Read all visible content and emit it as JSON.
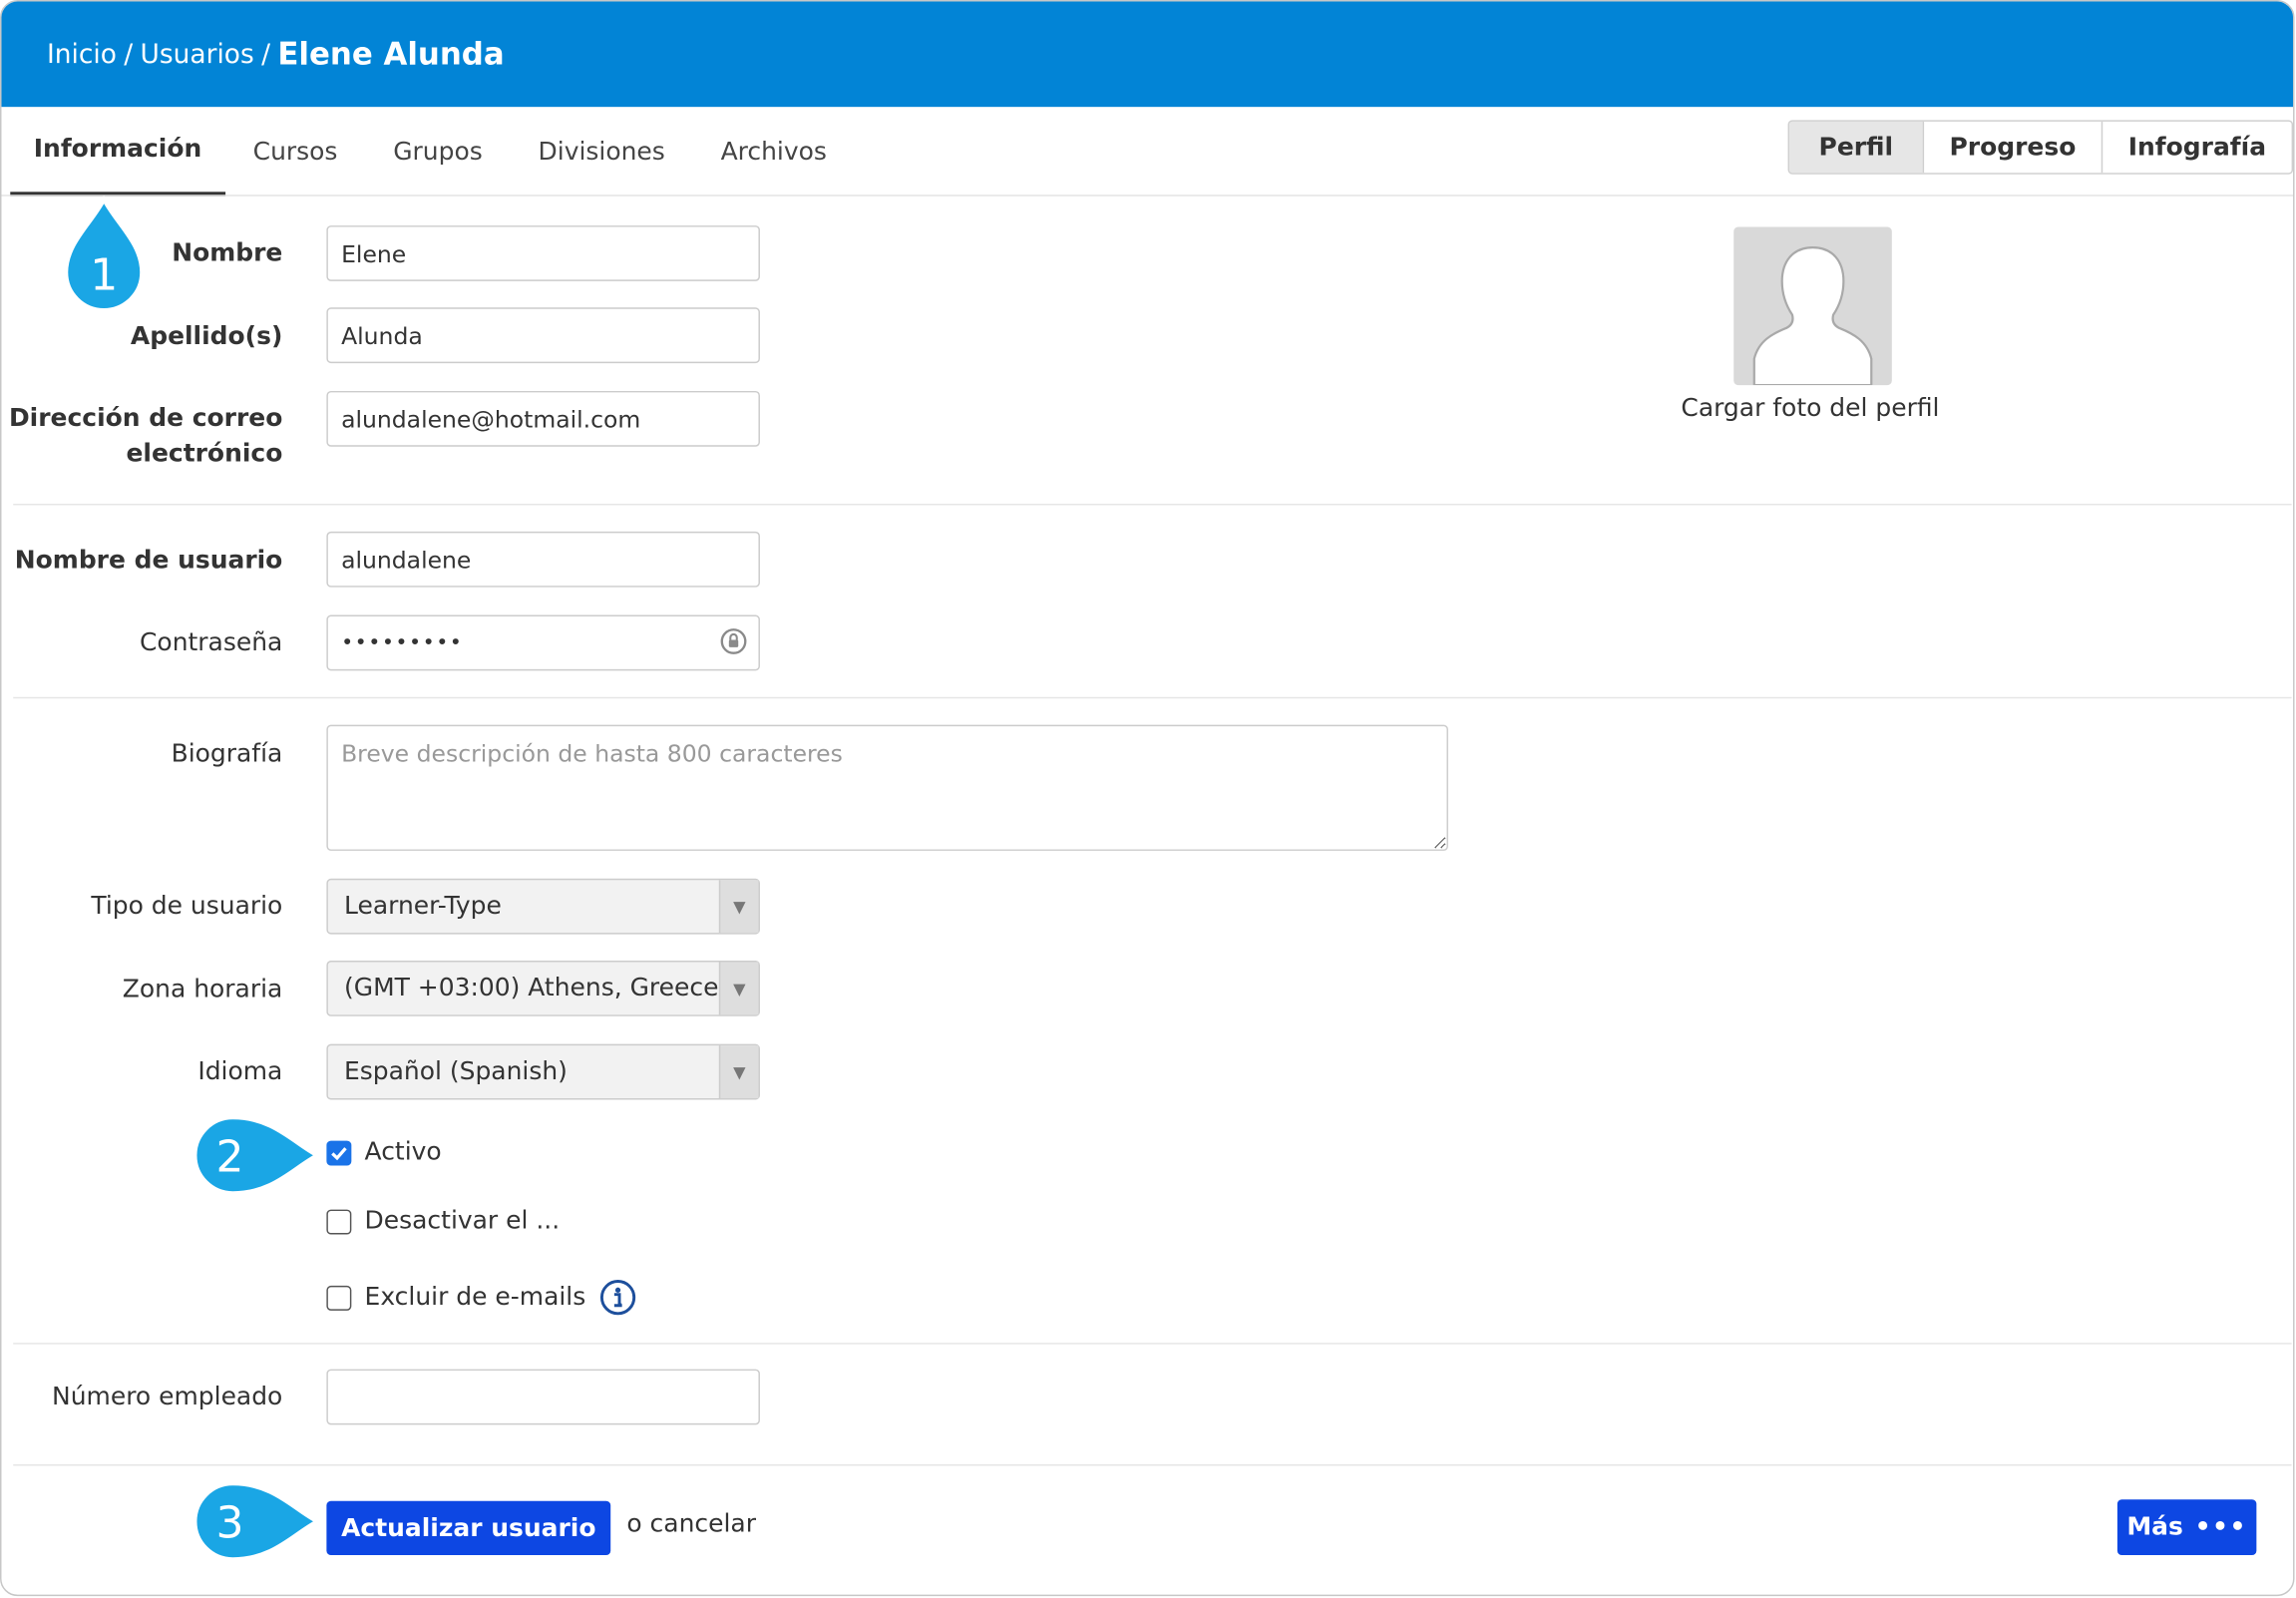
{
  "breadcrumb": {
    "home": "Inicio",
    "users": "Usuarios",
    "separator": "/",
    "current": "Elene Alunda"
  },
  "tabs": [
    {
      "label": "Información",
      "active": true
    },
    {
      "label": "Cursos"
    },
    {
      "label": "Grupos"
    },
    {
      "label": "Divisiones"
    },
    {
      "label": "Archivos"
    }
  ],
  "view_switch": [
    {
      "label": "Perfil",
      "active": true
    },
    {
      "label": "Progreso"
    },
    {
      "label": "Infografía"
    }
  ],
  "form": {
    "first_name": {
      "label": "Nombre",
      "value": "Elene"
    },
    "last_name": {
      "label": "Apellido(s)",
      "value": "Alunda"
    },
    "email": {
      "label_line1": "Dirección de correo",
      "label_line2": "electrónico",
      "value": "alundalene@hotmail.com"
    },
    "username": {
      "label": "Nombre de usuario",
      "value": "alundalene"
    },
    "password": {
      "label": "Contraseña",
      "value": "•••••••••"
    },
    "bio": {
      "label": "Biografía",
      "placeholder": "Breve descripción de hasta 800 caracteres"
    },
    "user_type": {
      "label": "Tipo de usuario",
      "value": "Learner-Type"
    },
    "timezone": {
      "label": "Zona horaria",
      "value": "(GMT +03:00) Athens, Greece"
    },
    "language": {
      "label": "Idioma",
      "value": "Español (Spanish)"
    },
    "active": {
      "label": "Activo",
      "checked": true
    },
    "deactivate": {
      "label": "Desactivar el ...",
      "checked": false
    },
    "exclude_emails": {
      "label": "Excluir de e-mails",
      "checked": false
    },
    "employee_number": {
      "label": "Número empleado",
      "value": ""
    }
  },
  "avatar": {
    "upload_label": "Cargar foto del perfil"
  },
  "actions": {
    "update": "Actualizar usuario",
    "cancel": "o cancelar",
    "more": "Más",
    "more_dots": "•••"
  },
  "callouts": [
    "1",
    "2",
    "3"
  ],
  "colors": {
    "header": "#0284d6",
    "primary_button": "#0d47e3",
    "callout": "#1aa6e5",
    "checkbox": "#1a73e8"
  }
}
